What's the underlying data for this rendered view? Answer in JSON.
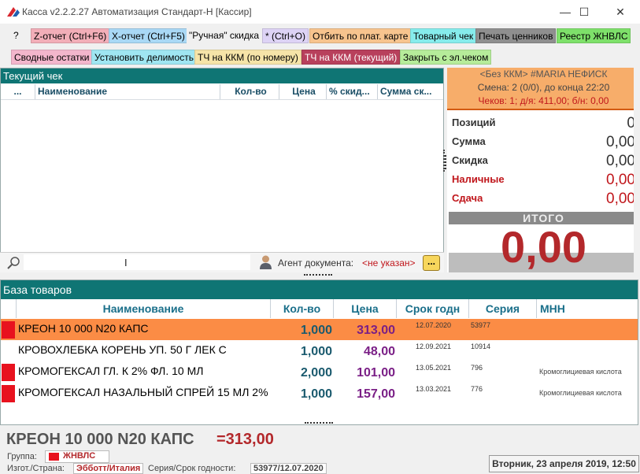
{
  "window": {
    "title": "Касса v2.2.2.27 Автоматизация Стандарт-Н [Кассир]",
    "minimize": "—",
    "maximize": "☐",
    "close": "✕"
  },
  "toolbar": {
    "row1": [
      {
        "label": "?",
        "color": "#f0f0f0"
      },
      {
        "label": "Z-отчет (Ctrl+F6)",
        "color": "#f2aeb8"
      },
      {
        "label": "X-отчет (Ctrl+F5)",
        "color": "#a9d8f5"
      },
      {
        "label": "\"Ручная\" скидка",
        "color": "#f0f0f0"
      },
      {
        "label": "* (Ctrl+O)",
        "color": "#ddd3f5"
      },
      {
        "label": "Отбить по плат. карте",
        "color": "#f7c48e"
      },
      {
        "label": "Товарный чек",
        "color": "#86ecec"
      },
      {
        "label": "Печать ценников",
        "color": "#8f8f8f"
      },
      {
        "label": "Реестр ЖНВЛС",
        "color": "#7ee06a"
      }
    ],
    "row2": [
      {
        "label": "Сводные остатки",
        "color": "#f3b6cc"
      },
      {
        "label": "Установить делимость",
        "color": "#9fe6f2"
      },
      {
        "label": "ТЧ на ККМ (по номеру)",
        "color": "#f6e4a8"
      },
      {
        "label": "ТЧ на ККМ (текущий)",
        "color": "#b8405c"
      },
      {
        "label": "Закрыть с эл.чеком",
        "color": "#b6ec9a"
      }
    ]
  },
  "receipt": {
    "title": "Текущий чек",
    "columns": [
      "...",
      "Наименование",
      "Кол-во",
      "Цена",
      "% скид...",
      "Сумма ск..."
    ],
    "agent_label": "Агент документа:",
    "agent_value": "<не указан>",
    "agent_button": "..."
  },
  "kkm": {
    "line1": "<Без ККМ> #MARIA НЕФИСК",
    "line2": "Смена: 2 (0/0), до конца 22:20",
    "line3": "Чеков: 1; д/я: 411,00; б/н: 0,00"
  },
  "summary": {
    "rows": [
      {
        "label": "Позиций",
        "value": "0",
        "color": "#333333"
      },
      {
        "label": "Сумма",
        "value": "0,00",
        "color": "#333333"
      },
      {
        "label": "Скидка",
        "value": "0,00",
        "color": "#333333"
      },
      {
        "label": "Наличные",
        "value": "0,00",
        "color": "#c0161b"
      },
      {
        "label": "Сдача",
        "value": "0,00",
        "color": "#c0161b"
      }
    ],
    "total_label": "ИТОГО",
    "total_value": "0,00"
  },
  "goods": {
    "title": "База товаров",
    "columns": [
      "Наименование",
      "Кол-во",
      "Цена",
      "Срок годн",
      "Серия",
      "МНН"
    ],
    "rows": [
      {
        "name": "КРЕОН 10 000 N20 КАПС",
        "qty": "1,000",
        "price": "313,00",
        "expiry": "12.07.2020",
        "series": "53977",
        "mnn": "",
        "marked": true,
        "selected": true
      },
      {
        "name": "КРОВОХЛЕБКА КОРЕНЬ УП. 50 Г ЛЕК С",
        "qty": "1,000",
        "price": "48,00",
        "expiry": "12.09.2021",
        "series": "10914",
        "mnn": "",
        "marked": false,
        "selected": false
      },
      {
        "name": "КРОМОГЕКСАЛ ГЛ. К 2% ФЛ. 10 МЛ",
        "qty": "2,000",
        "price": "101,00",
        "expiry": "13.05.2021",
        "series": "796",
        "mnn": "Кромоглициевая кислота",
        "marked": true,
        "selected": false
      },
      {
        "name": "КРОМОГЕКСАЛ НАЗАЛЬНЫЙ СПРЕЙ 15 МЛ 2%",
        "qty": "1,000",
        "price": "157,00",
        "expiry": "13.03.2021",
        "series": "776",
        "mnn": "Кромоглициевая кислота",
        "marked": true,
        "selected": false
      }
    ]
  },
  "details": {
    "product_name": "КРЕОН 10 000 N20 КАПС",
    "product_price": "=313,00",
    "group_label": "Группа:",
    "group_value": "ЖНВЛС",
    "maker_label": "Изгот./Страна:",
    "maker_value": "Эбботт/Италия",
    "series_label": "Серия/Срок годности:",
    "series_value": "53977/12.07.2020",
    "datetime": "Вторник, 23 апреля 2019, 12:50"
  },
  "colors": {
    "teal": "#0f7574",
    "selected_row": "#fb8c45",
    "marker": "#e8121e",
    "kkm_bg": "#f7ad6a",
    "total_red": "#b3282b"
  }
}
